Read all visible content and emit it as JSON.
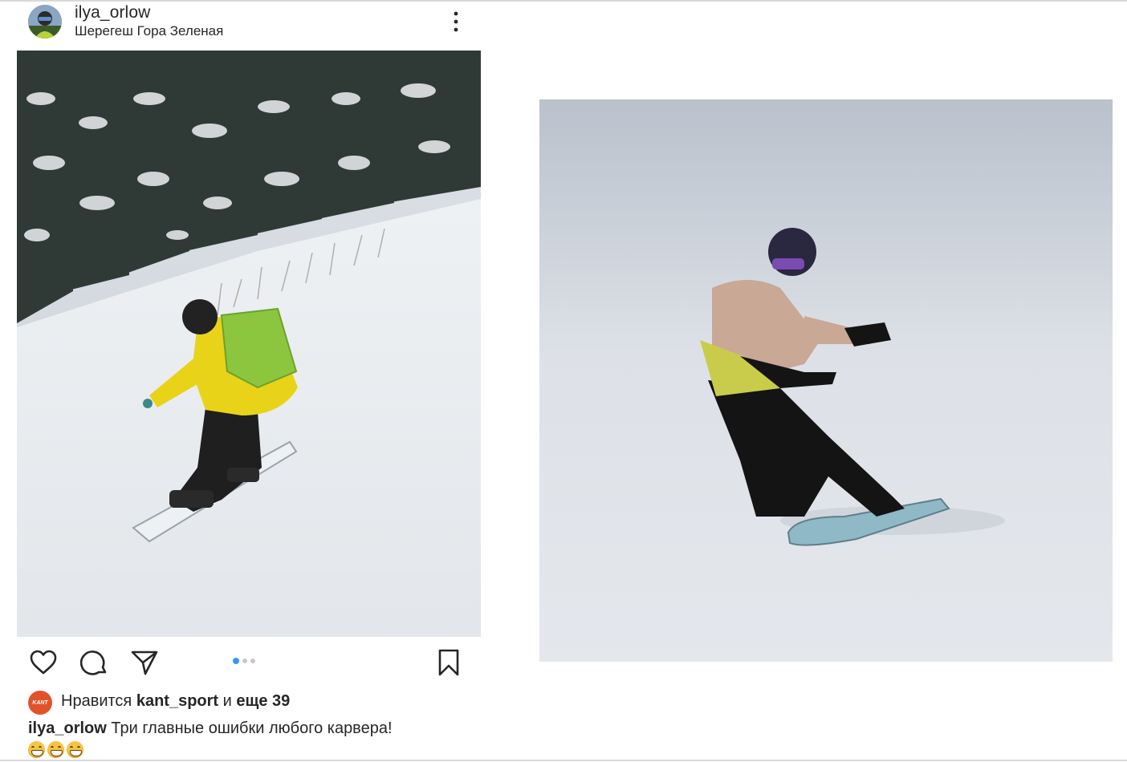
{
  "post": {
    "username": "ilya_orlow",
    "location": "Шерегеш Гора Зеленая",
    "carousel": {
      "total": 3,
      "active": 1
    },
    "likes": {
      "prefix": "Нравится",
      "liked_by": "kant_sport",
      "connector": "и",
      "others": "еще 39",
      "liker_avatar_text": "KANT"
    },
    "caption": {
      "username": "ilya_orlow",
      "text": "Три главные ошибки любого карвера!",
      "emoji": [
        "grin",
        "grin",
        "grin"
      ]
    }
  },
  "icons": {
    "more": "more-vertical-icon",
    "like": "heart-icon",
    "comment": "comment-bubble-icon",
    "share": "paper-plane-icon",
    "save": "bookmark-icon"
  },
  "colors": {
    "text": "#262626",
    "active_dot": "#3897f0",
    "inactive_dot": "#c7c7c7",
    "kant_brand": "#e0532a",
    "jacket_yellow": "#e8d318",
    "backpack_green": "#8cc63f"
  }
}
